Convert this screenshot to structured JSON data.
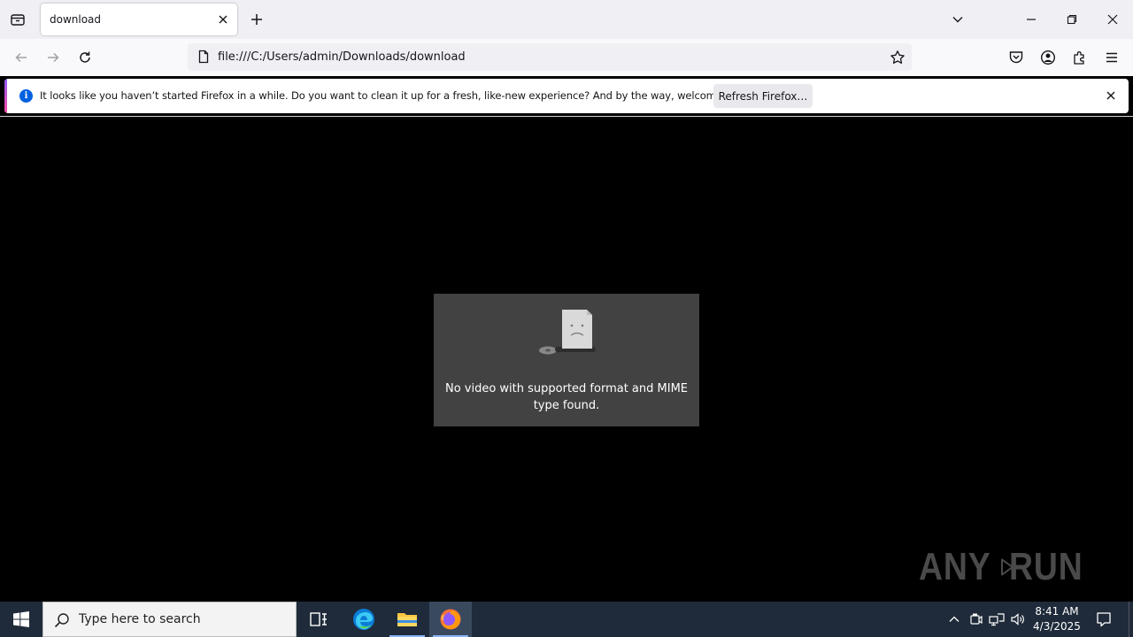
{
  "browser": {
    "tab": {
      "title": "download"
    },
    "urlbar": {
      "url": "file:///C:/Users/admin/Downloads/download"
    },
    "icons": [
      "tab-list-icon",
      "close-icon",
      "plus-icon",
      "chevron-down-icon",
      "minimize-icon",
      "restore-icon",
      "window-close-icon",
      "back-arrow-icon",
      "forward-arrow-icon",
      "reload-icon",
      "page-icon",
      "star-icon",
      "pocket-icon",
      "account-icon",
      "extensions-icon",
      "menu-icon"
    ]
  },
  "notification": {
    "message": "It looks like you haven’t started Firefox in a while. Do you want to clean it up for a fresh, like-new experience? And by the way, welcome back!",
    "button_label": "Refresh Firefox…",
    "accent_colors": [
      "#9059ff",
      "#ff4aa2"
    ],
    "info_color": "#0060df",
    "info_glyph": "i"
  },
  "video": {
    "error_message": "No video with supported format and MIME type found."
  },
  "watermark": {
    "left": "ANY",
    "right": "RUN"
  },
  "taskbar": {
    "search_placeholder": "Type here to search",
    "apps": [
      "task-view",
      "edge",
      "file-explorer",
      "firefox"
    ],
    "active_app": "firefox",
    "clock": {
      "time": "8:41 AM",
      "date": "4/3/2025"
    }
  }
}
